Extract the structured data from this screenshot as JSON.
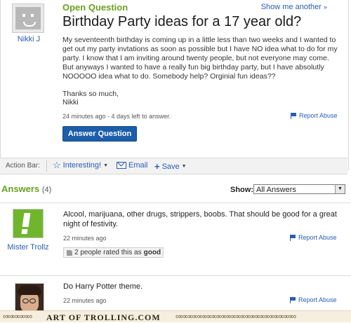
{
  "question": {
    "status": "Open Question",
    "show_more": "Show me another",
    "show_more_arrow": "»",
    "title": "Birthday Party ideas for a 17 year old?",
    "body": "My seventeenth birthday is coming up in a little less than two weeks and I wanted to get out my party invtations as soon as possible but I have NO idea what to do for my party. I know that I am inviting around twenty people, but not everyone may come. But anyways I wanted to have a really fun big birthday party, but I have absolutly NOOOOO idea what to do. Somebody help? Orginial fun ideas??",
    "thanks": "Thanks so much,",
    "signature": "Nikki",
    "meta": "24 minutes ago - 4 days left to answer.",
    "report": "Report Abuse",
    "answer_button": "Answer Question",
    "asker": {
      "name": "Nikki J",
      "avatar_icon": "default-avatar-icon"
    }
  },
  "action_bar": {
    "label": "Action Bar:",
    "interesting": "Interesting!",
    "email": "Email",
    "save": "Save"
  },
  "answers": {
    "heading": "Answers",
    "count": "(4)",
    "show_label": "Show:",
    "filter": "All Answers",
    "items": [
      {
        "author": "Mister Trollz",
        "text": "Alcool, marijuana, other drugs, strippers, boobs. That should be good for a great night of festivity.",
        "time": "22 minutes ago",
        "report": "Report Abuse",
        "rated_prefix": "2 people rated this as",
        "rated_value": "good"
      },
      {
        "author": "",
        "text": "Do Harry Potter theme.",
        "time": "22 minutes ago",
        "report": "Report Abuse"
      }
    ]
  },
  "footer": {
    "text": "ART OF TROLLING.COM"
  },
  "colors": {
    "accent_green": "#6aa121",
    "link_blue": "#2a5db0",
    "button_blue": "#1b5ea9"
  }
}
